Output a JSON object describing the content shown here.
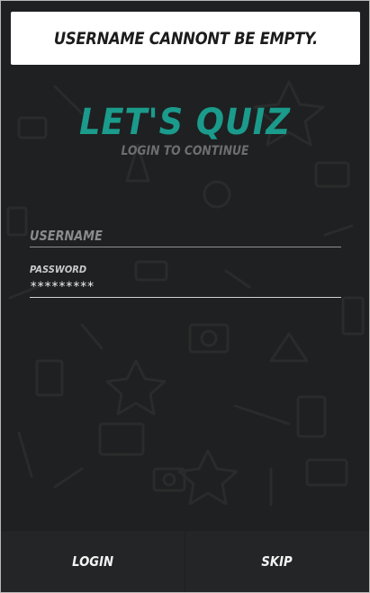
{
  "toast": {
    "message": "USERNAME CANNONT BE EMPTY."
  },
  "header": {
    "title": "LET'S QUIZ",
    "subtitle": "LOGIN TO CONTINUE"
  },
  "form": {
    "username": {
      "placeholder": "USERNAME",
      "value": ""
    },
    "password": {
      "label": "PASSWORD",
      "value": "*********"
    }
  },
  "actions": {
    "login_label": "LOGIN",
    "skip_label": "SKIP"
  },
  "theme": {
    "accent": "#1a9b8c",
    "background": "#1f2021",
    "button_bg": "#242526"
  }
}
